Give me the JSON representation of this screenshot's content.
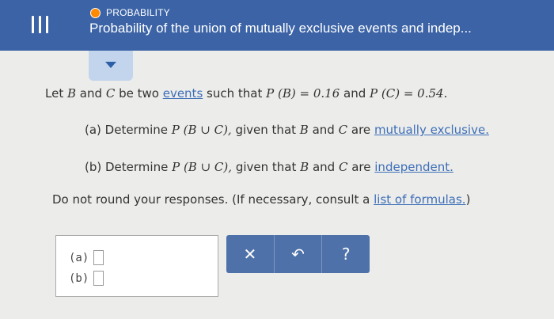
{
  "header": {
    "section": "PROBABILITY",
    "title": "Probability of the union of mutually exclusive events and indep..."
  },
  "colors": {
    "header_bg": "#3b63a6",
    "section_dot": "#ff8a00",
    "link": "#3d6fb8",
    "toolbar_bg": "#4d71a8"
  },
  "problem": {
    "intro_before": "Let",
    "var_b": "B",
    "and": "and",
    "var_c": "C",
    "be_two": "be two",
    "events_link": "events",
    "such_that": "such that",
    "pb": "P (B) = 0.16",
    "pc": "P (C) = 0.54.",
    "a_text": "(a) Determine",
    "union": "P (B ∪ C),",
    "given_that": "given that",
    "are": "are",
    "mutually_exclusive_link": "mutually exclusive.",
    "b_text": "(b) Determine",
    "independent_link": "independent.",
    "rounding_note": "Do not round your responses. (If necessary, consult a",
    "formulas_link": "list of formulas.",
    "close_paren": ")"
  },
  "answers": {
    "a_label": "(a)",
    "b_label": "(b)"
  },
  "toolbar": {
    "clear": "✕",
    "undo": "↶",
    "help": "?"
  },
  "icons": [
    "menu-icon",
    "section-dot-icon",
    "chevron-down-icon",
    "close-icon",
    "undo-icon",
    "help-icon"
  ]
}
